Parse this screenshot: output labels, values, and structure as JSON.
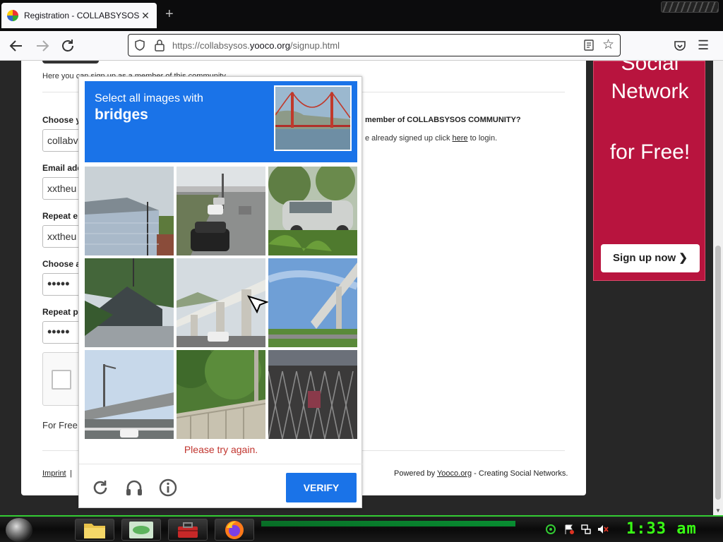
{
  "browser": {
    "tab_title": "Registration - COLLABSYSOS COMMUNITY",
    "tab_close": "✕",
    "new_tab": "+",
    "url_prefix": "https://collabsysos.",
    "url_host": "yooco.org",
    "url_path": "/signup.html"
  },
  "page": {
    "intro": "Here you can sign up as a member of this community.",
    "fields": [
      {
        "label": "Choose y",
        "value": "collabv"
      },
      {
        "label": "Email add",
        "value": "xxtheu"
      },
      {
        "label": "Repeat e",
        "value": "xxtheu"
      },
      {
        "label": "Choose a",
        "value": "•••••"
      },
      {
        "label": "Repeat p",
        "value": "•••••"
      }
    ],
    "free_text": "For Free",
    "member_heading": "member of COLLABSYSOS COMMUNITY?",
    "member_text_before": "e already signed up click ",
    "member_link": "here",
    "member_text_after": " to login.",
    "footer_imprint": "Imprint",
    "footer_pipe": "|",
    "powered_before": "Powered by ",
    "powered_link": "Yooco.org",
    "powered_after": " - Creating Social Networks."
  },
  "ad": {
    "line1": "Social",
    "line2": "Network",
    "line3": "for Free!",
    "button": "Sign up now ❯"
  },
  "captcha": {
    "lead": "Select all images with",
    "keyword": "bridges",
    "error": "Please try again.",
    "verify": "VERIFY",
    "brand_blue": "#1a73e8",
    "error_red": "#c1352f"
  },
  "taskbar": {
    "clock": "1:33 am",
    "apps": [
      "folder-icon",
      "acer-app-icon",
      "toolbox-icon",
      "firefox-icon"
    ]
  }
}
